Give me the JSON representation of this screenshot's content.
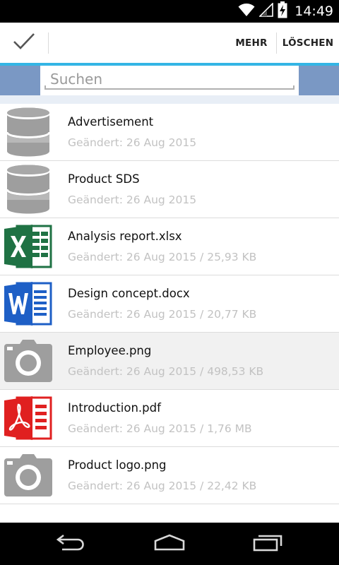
{
  "status_bar": {
    "time": "14:49",
    "icons": [
      "wifi-icon",
      "signal-icon",
      "battery-charging-icon"
    ]
  },
  "action_bar": {
    "done_icon": "checkmark-icon",
    "more_label": "MEHR",
    "delete_label": "LÖSCHEN",
    "accent_color": "#33b5e5"
  },
  "search": {
    "placeholder": "Suchen",
    "value": ""
  },
  "files": [
    {
      "name": "Advertisement",
      "meta": "Geändert: 26 Aug 2015",
      "icon": "database-icon",
      "selected": false
    },
    {
      "name": "Product SDS",
      "meta": "Geändert: 26 Aug 2015",
      "icon": "database-icon",
      "selected": false
    },
    {
      "name": "Analysis report.xlsx",
      "meta": "Geändert: 26 Aug 2015 / 25,93 KB",
      "icon": "excel-file-icon",
      "selected": false
    },
    {
      "name": "Design concept.docx",
      "meta": "Geändert: 26 Aug 2015 / 20,77 KB",
      "icon": "word-file-icon",
      "selected": false
    },
    {
      "name": "Employee.png",
      "meta": "Geändert: 26 Aug 2015 / 498,53 KB",
      "icon": "camera-icon",
      "selected": true
    },
    {
      "name": "Introduction.pdf",
      "meta": "Geändert: 26 Aug 2015 / 1,76 MB",
      "icon": "pdf-file-icon",
      "selected": false
    },
    {
      "name": "Product logo.png",
      "meta": "Geändert: 26 Aug 2015 / 22,42 KB",
      "icon": "camera-icon",
      "selected": false
    }
  ],
  "nav_bar": {
    "icons": [
      "back-icon",
      "home-icon",
      "recents-icon"
    ]
  },
  "colors": {
    "excel": "#1f7244",
    "word": "#1e5fc6",
    "pdf": "#e02020",
    "grey_icon": "#9e9e9e",
    "search_band": "#7a98c4"
  }
}
